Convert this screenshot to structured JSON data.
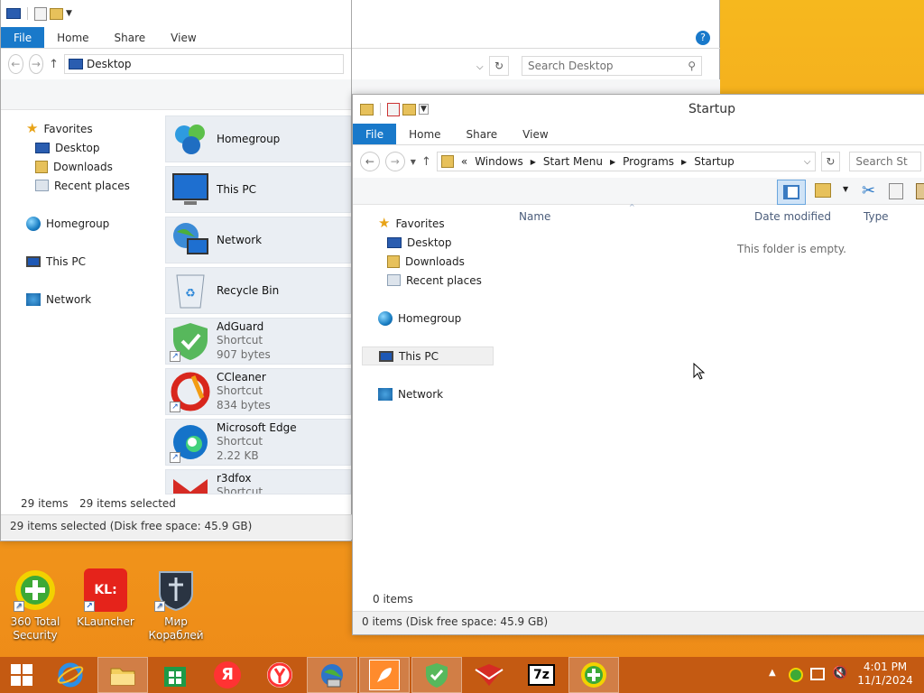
{
  "left_window": {
    "ribbon_tabs": [
      "File",
      "Home",
      "Share",
      "View"
    ],
    "address": "Desktop",
    "search_placeholder": "Search Desktop",
    "nav": {
      "favorites": "Favorites",
      "desktop": "Desktop",
      "downloads": "Downloads",
      "recent": "Recent places",
      "homegroup": "Homegroup",
      "this_pc": "This PC",
      "network": "Network"
    },
    "items": [
      {
        "name": "Homegroup",
        "type": "",
        "size": ""
      },
      {
        "name": "This PC",
        "type": "",
        "size": ""
      },
      {
        "name": "Network",
        "type": "",
        "size": ""
      },
      {
        "name": "Recycle Bin",
        "type": "",
        "size": ""
      },
      {
        "name": "AdGuard",
        "type": "Shortcut",
        "size": "907 bytes"
      },
      {
        "name": "CCleaner",
        "type": "Shortcut",
        "size": "834 bytes"
      },
      {
        "name": "Microsoft Edge",
        "type": "Shortcut",
        "size": "2.22 KB"
      },
      {
        "name": "r3dfox",
        "type": "Shortcut",
        "size": ""
      }
    ],
    "status_count": "29 items",
    "status_selected": "29 items selected",
    "status_bottom": "29 items selected (Disk free space: 45.9 GB)"
  },
  "right_window": {
    "title": "Startup",
    "ribbon_tabs": [
      "File",
      "Home",
      "Share",
      "View"
    ],
    "breadcrumb": [
      "«",
      "Windows",
      "Start Menu",
      "Programs",
      "Startup"
    ],
    "search_placeholder": "Search St",
    "nav": {
      "favorites": "Favorites",
      "desktop": "Desktop",
      "downloads": "Downloads",
      "recent": "Recent places",
      "homegroup": "Homegroup",
      "this_pc": "This PC",
      "network": "Network"
    },
    "columns": [
      "Name",
      "Date modified",
      "Type"
    ],
    "empty_message": "This folder is empty.",
    "status_count": "0 items",
    "status_bottom": "0 items (Disk free space: 45.9 GB)"
  },
  "desktop_icons": [
    {
      "label_line1": "360 Total",
      "label_line2": "Security"
    },
    {
      "label_line1": "KLauncher",
      "label_line2": ""
    },
    {
      "label_line1": "Мир",
      "label_line2": "Кораблей"
    }
  ],
  "taskbar": {
    "klauncher_badge": "KL:",
    "sevenzip_label": "7z",
    "yandex_letter": "Я",
    "time": "4:01 PM",
    "date": "11/1/2024"
  },
  "colors": {
    "accent_file_tab": "#1979ca",
    "taskbar": "#c45a12",
    "desktop": "#f29d1c"
  }
}
